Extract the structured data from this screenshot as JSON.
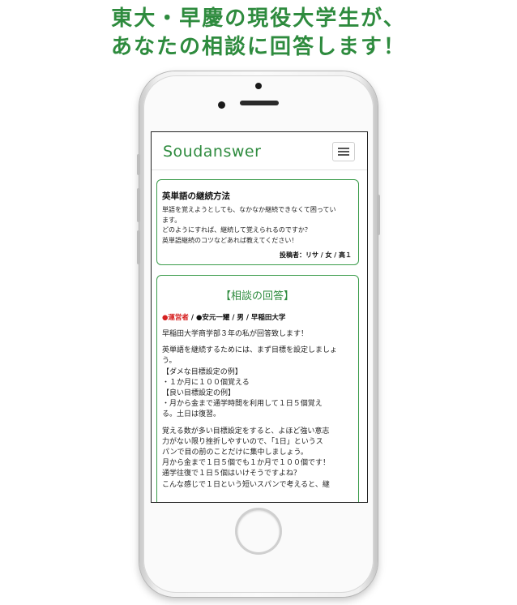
{
  "headline": {
    "line1": "東大・早慶の現役大学生が、",
    "line2": "あなたの相談に回答します！"
  },
  "app": {
    "brand": "Soudanswer",
    "menu_icon": "hamburger-menu-icon"
  },
  "question": {
    "title": "英単語の継続方法",
    "body_lines": [
      "単語を覚えようとしても、なかなか継続できなくて困ってい",
      "ます。",
      "どのようにすれば、継続して覚えられるのですか？",
      "英単語継続のコツなどあれば教えてください！"
    ],
    "poster": "投稿者：リサ / 女 / 高１"
  },
  "answer": {
    "heading": "【相談の回答】",
    "role": "●運営者",
    "meta_rest": " / ●安元一耀 / 男 / 早稲田大学",
    "para1": [
      "早稲田大学商学部３年の私が回答致します！"
    ],
    "para2": [
      "英単語を継続するためには、まず目標を設定しましょ",
      "う。",
      "【ダメな目標設定の例】",
      "・１か月に１００個覚える",
      "【良い目標設定の例】",
      "・月から金まで通学時間を利用して１日５個覚え",
      "る。土日は復習。"
    ],
    "para3": [
      "覚える数が多い目標設定をすると、よほど強い意志",
      "力がない限り挫折しやすいので、「1日」というス",
      "パンで目の前のことだけに集中しましょう。",
      "月から金まで１日５個でも１か月で１００個です！",
      "通学往復で１日５個はいけそうですよね？",
      "こんな感じで１日という短いスパンで考えると、継"
    ]
  },
  "colors": {
    "accent_green": "#2e8b3e",
    "card_border": "#3a9b4a",
    "role_red": "#d62020"
  }
}
